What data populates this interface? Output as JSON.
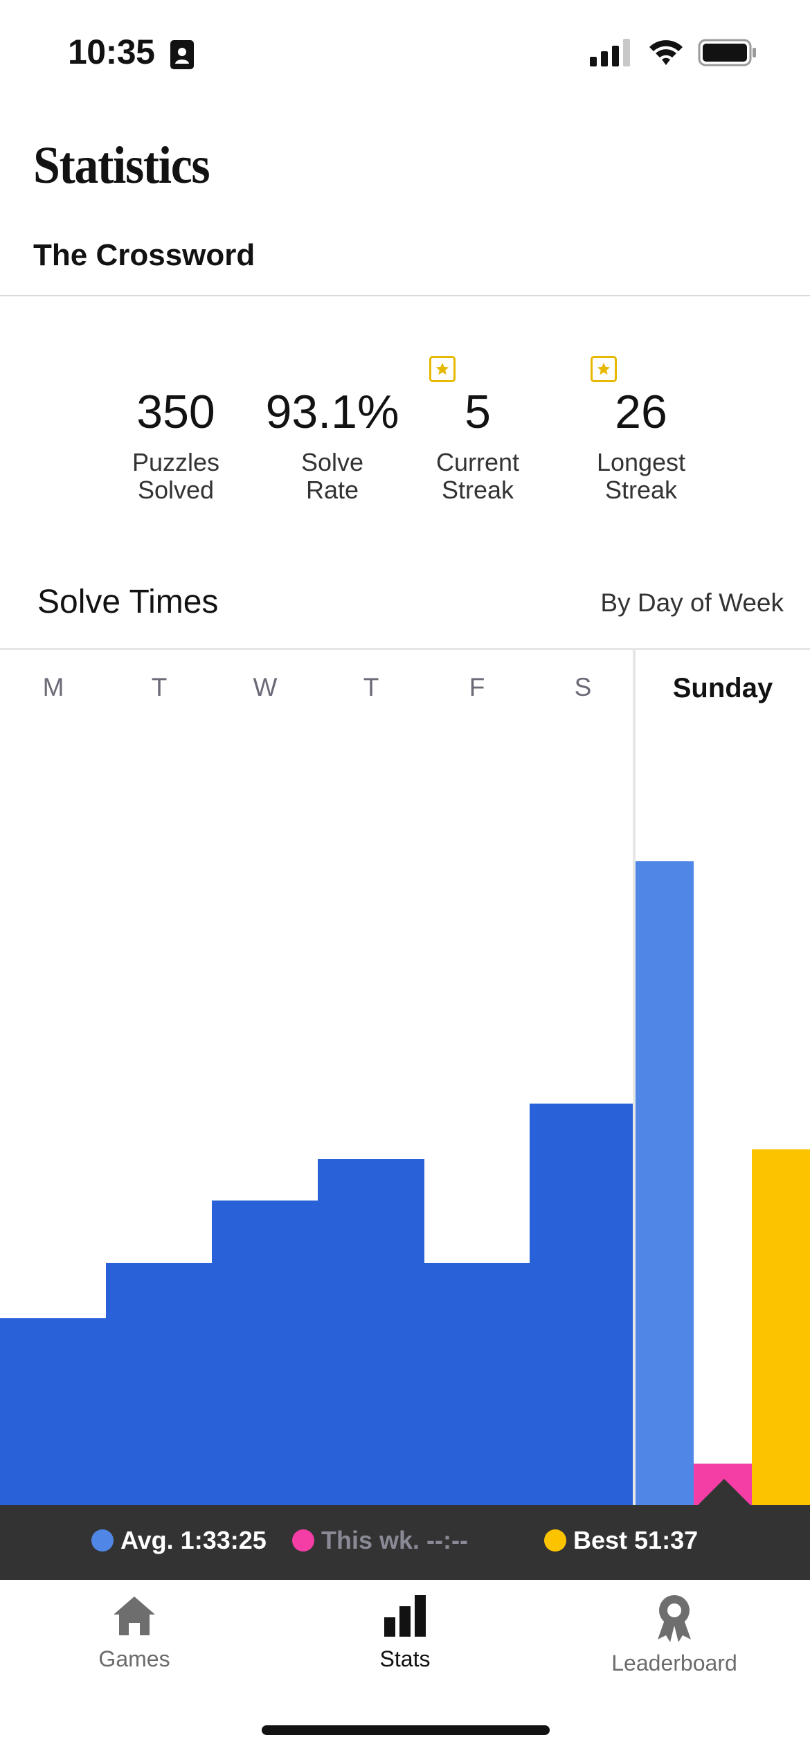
{
  "status_bar": {
    "time": "10:35"
  },
  "header": {
    "title": "Statistics",
    "subtitle": "The Crossword"
  },
  "stats": [
    {
      "value": "350",
      "label_line1": "Puzzles",
      "label_line2": "Solved",
      "starred": false
    },
    {
      "value": "93.1%",
      "label_line1": "Solve",
      "label_line2": "Rate",
      "starred": false
    },
    {
      "value": "5",
      "label_line1": "Current",
      "label_line2": "Streak",
      "starred": true
    },
    {
      "value": "26",
      "label_line1": "Longest",
      "label_line2": "Streak",
      "starred": true
    }
  ],
  "solve_times": {
    "title": "Solve Times",
    "filter": "By Day of Week",
    "days": [
      "M",
      "T",
      "W",
      "T",
      "F",
      "S",
      "Sunday"
    ],
    "selected_day": "Sunday"
  },
  "chart_data": {
    "type": "bar",
    "categories": [
      "M",
      "T",
      "W",
      "T",
      "F",
      "S",
      "Sunday"
    ],
    "series": [
      {
        "name": "Avg.",
        "values": [
          null,
          null,
          null,
          null,
          null,
          null,
          5605
        ],
        "color": "#5087e6"
      },
      {
        "name": "This wk.",
        "values": [
          null,
          null,
          null,
          null,
          null,
          null,
          null
        ],
        "color": "#f53ea5"
      },
      {
        "name": "Best",
        "values": [
          null,
          null,
          null,
          null,
          null,
          null,
          3097
        ],
        "color": "#fcc400"
      }
    ],
    "relative_heights": [
      0.27,
      0.35,
      0.44,
      0.5,
      0.35,
      0.58,
      0.93
    ],
    "bar_color": "#2962d8"
  },
  "legend": {
    "avg": {
      "label": "Avg. 1:33:25",
      "color": "#5087e6"
    },
    "this_week": {
      "label": "This wk. --:--",
      "color": "#f53ea5"
    },
    "best": {
      "label": "Best 51:37",
      "color": "#fcc400"
    }
  },
  "tabs": [
    {
      "label": "Games",
      "active": false
    },
    {
      "label": "Stats",
      "active": true
    },
    {
      "label": "Leaderboard",
      "active": false
    }
  ]
}
